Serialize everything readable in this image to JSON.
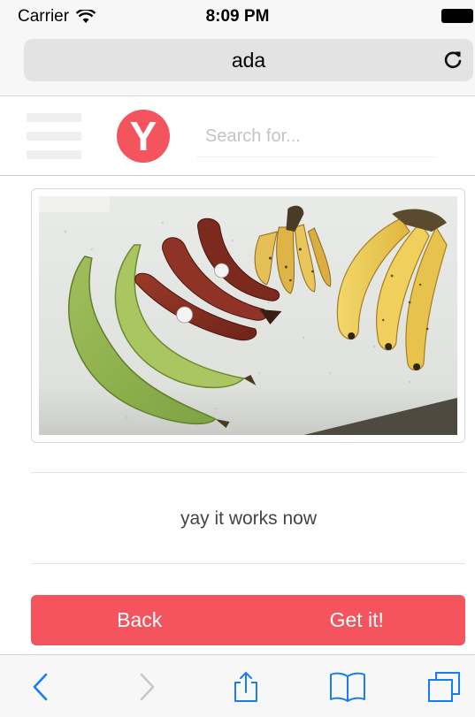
{
  "status_bar": {
    "carrier": "Carrier",
    "time": "8:09 PM",
    "icons": [
      "wifi-icon",
      "battery-icon"
    ]
  },
  "address_bar": {
    "url": "ada",
    "reload_icon": "reload-icon"
  },
  "header": {
    "menu_icon": "hamburger-menu-icon",
    "logo_letter": "Y",
    "search_placeholder": "Search for...",
    "search_value": ""
  },
  "content": {
    "image": "photo of green plantains, red bananas, small bananas and yellow bananas on a countertop",
    "message": "yay it works now"
  },
  "actions": {
    "back_label": "Back",
    "get_label": "Get it!"
  },
  "toolbar": {
    "items": [
      "back-icon",
      "forward-icon",
      "share-icon",
      "bookmarks-icon",
      "tabs-icon"
    ]
  },
  "colors": {
    "accent": "#f4545e",
    "ios_blue": "#1a7cf5",
    "disabled": "#c7c7cc"
  }
}
